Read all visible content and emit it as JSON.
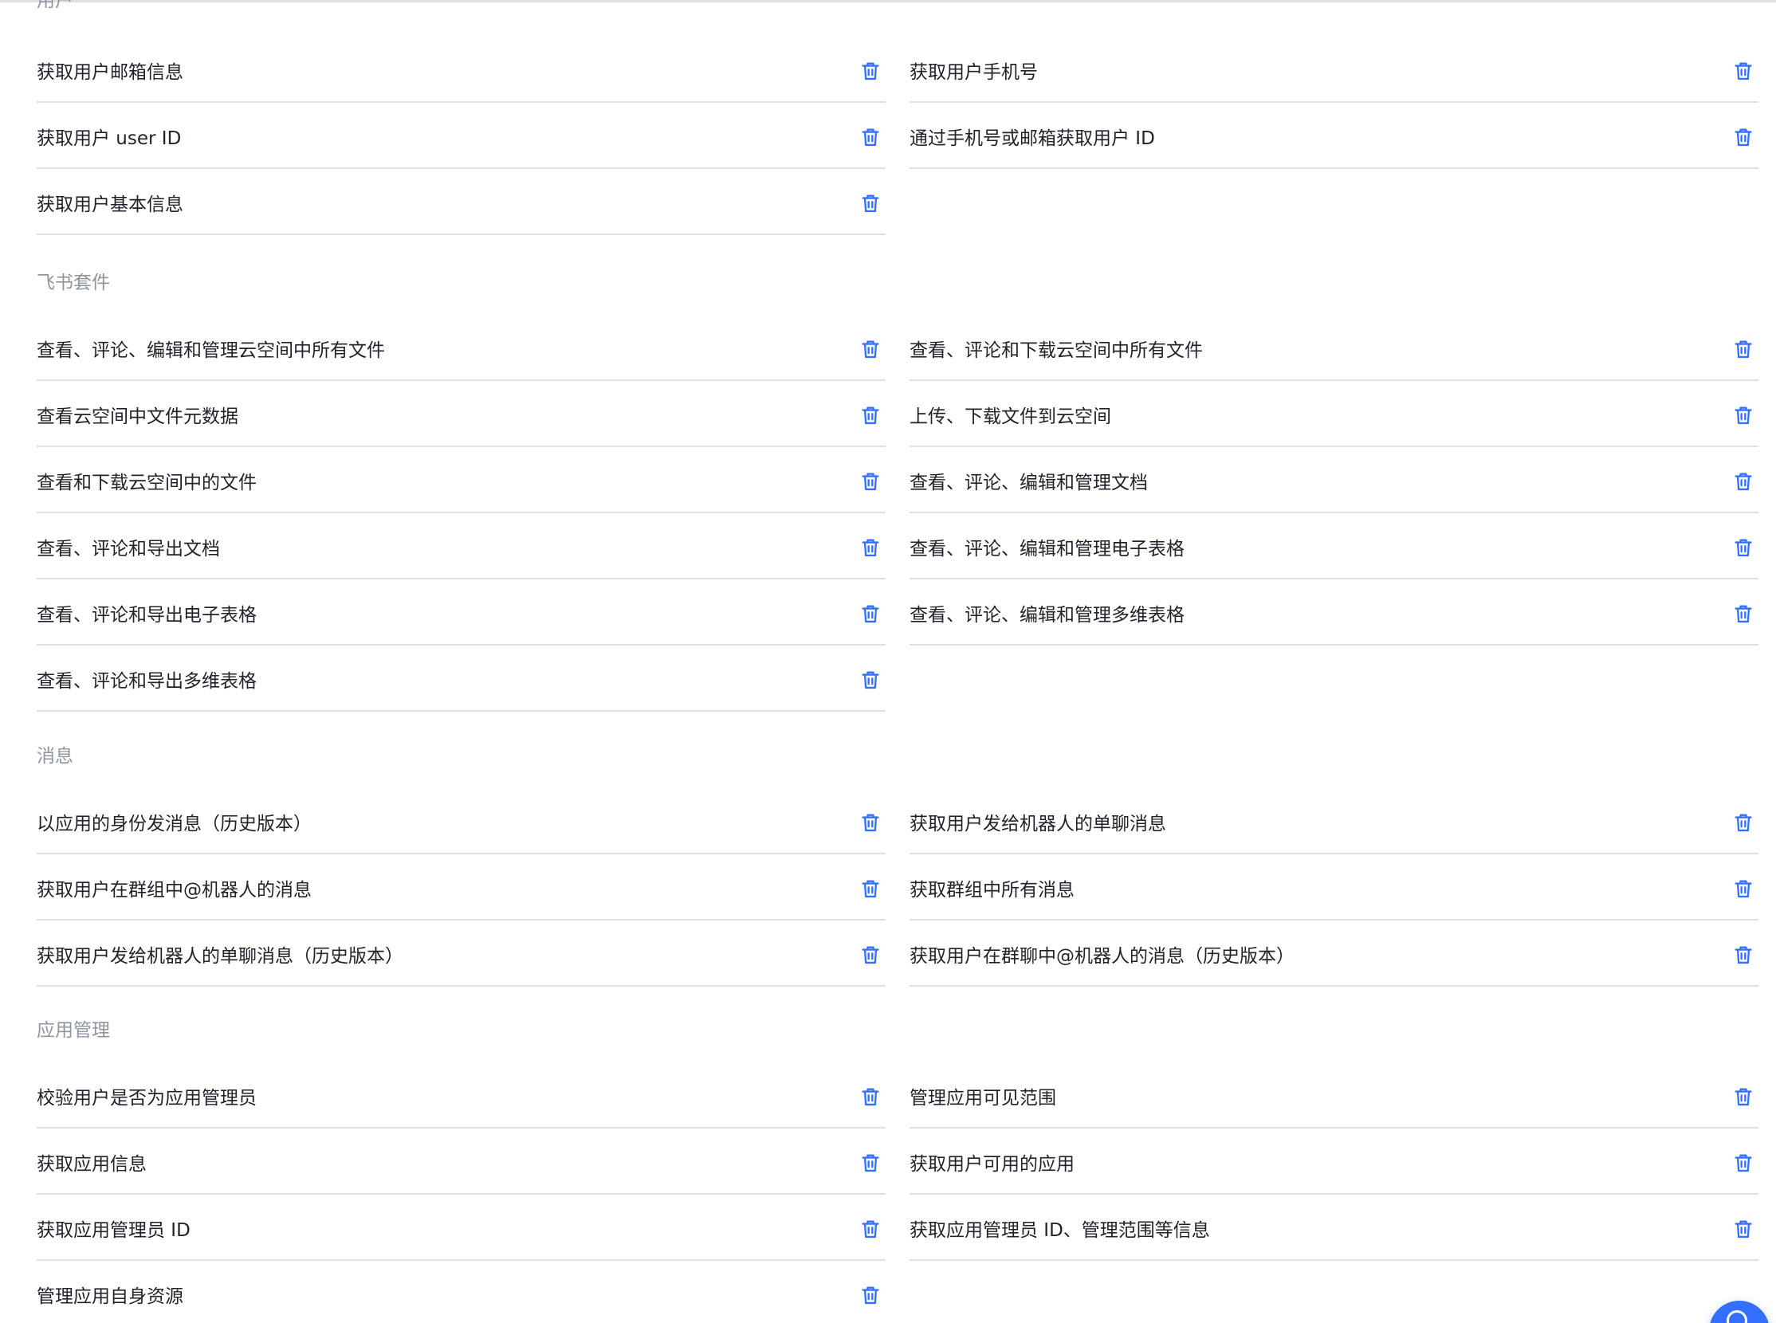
{
  "sections": {
    "user": {
      "title": "用户",
      "items": [
        "获取用户邮箱信息",
        "获取用户手机号",
        "获取用户 user ID",
        "通过手机号或邮箱获取用户 ID",
        "获取用户基本信息"
      ]
    },
    "suite": {
      "title": "飞书套件",
      "items": [
        "查看、评论、编辑和管理云空间中所有文件",
        "查看、评论和下载云空间中所有文件",
        "查看云空间中文件元数据",
        "上传、下载文件到云空间",
        "查看和下载云空间中的文件",
        "查看、评论、编辑和管理文档",
        "查看、评论和导出文档",
        "查看、评论、编辑和管理电子表格",
        "查看、评论和导出电子表格",
        "查看、评论、编辑和管理多维表格",
        "查看、评论和导出多维表格"
      ]
    },
    "message": {
      "title": "消息",
      "items": [
        "以应用的身份发消息（历史版本）",
        "获取用户发给机器人的单聊消息",
        "获取用户在群组中@机器人的消息",
        "获取群组中所有消息",
        "获取用户发给机器人的单聊消息（历史版本）",
        "获取用户在群聊中@机器人的消息（历史版本）"
      ]
    },
    "app_manage": {
      "title": "应用管理",
      "items": [
        "校验用户是否为应用管理员",
        "管理应用可见范围",
        "获取应用信息",
        "获取用户可用的应用",
        "获取应用管理员 ID",
        "获取应用管理员 ID、管理范围等信息",
        "管理应用自身资源"
      ]
    }
  },
  "icons": {
    "delete": "trash-icon",
    "help": "help-icon"
  },
  "colors": {
    "accent": "#3370ff",
    "text": "#1f2329",
    "section_title": "#8f959e",
    "divider": "#dee0e3"
  }
}
